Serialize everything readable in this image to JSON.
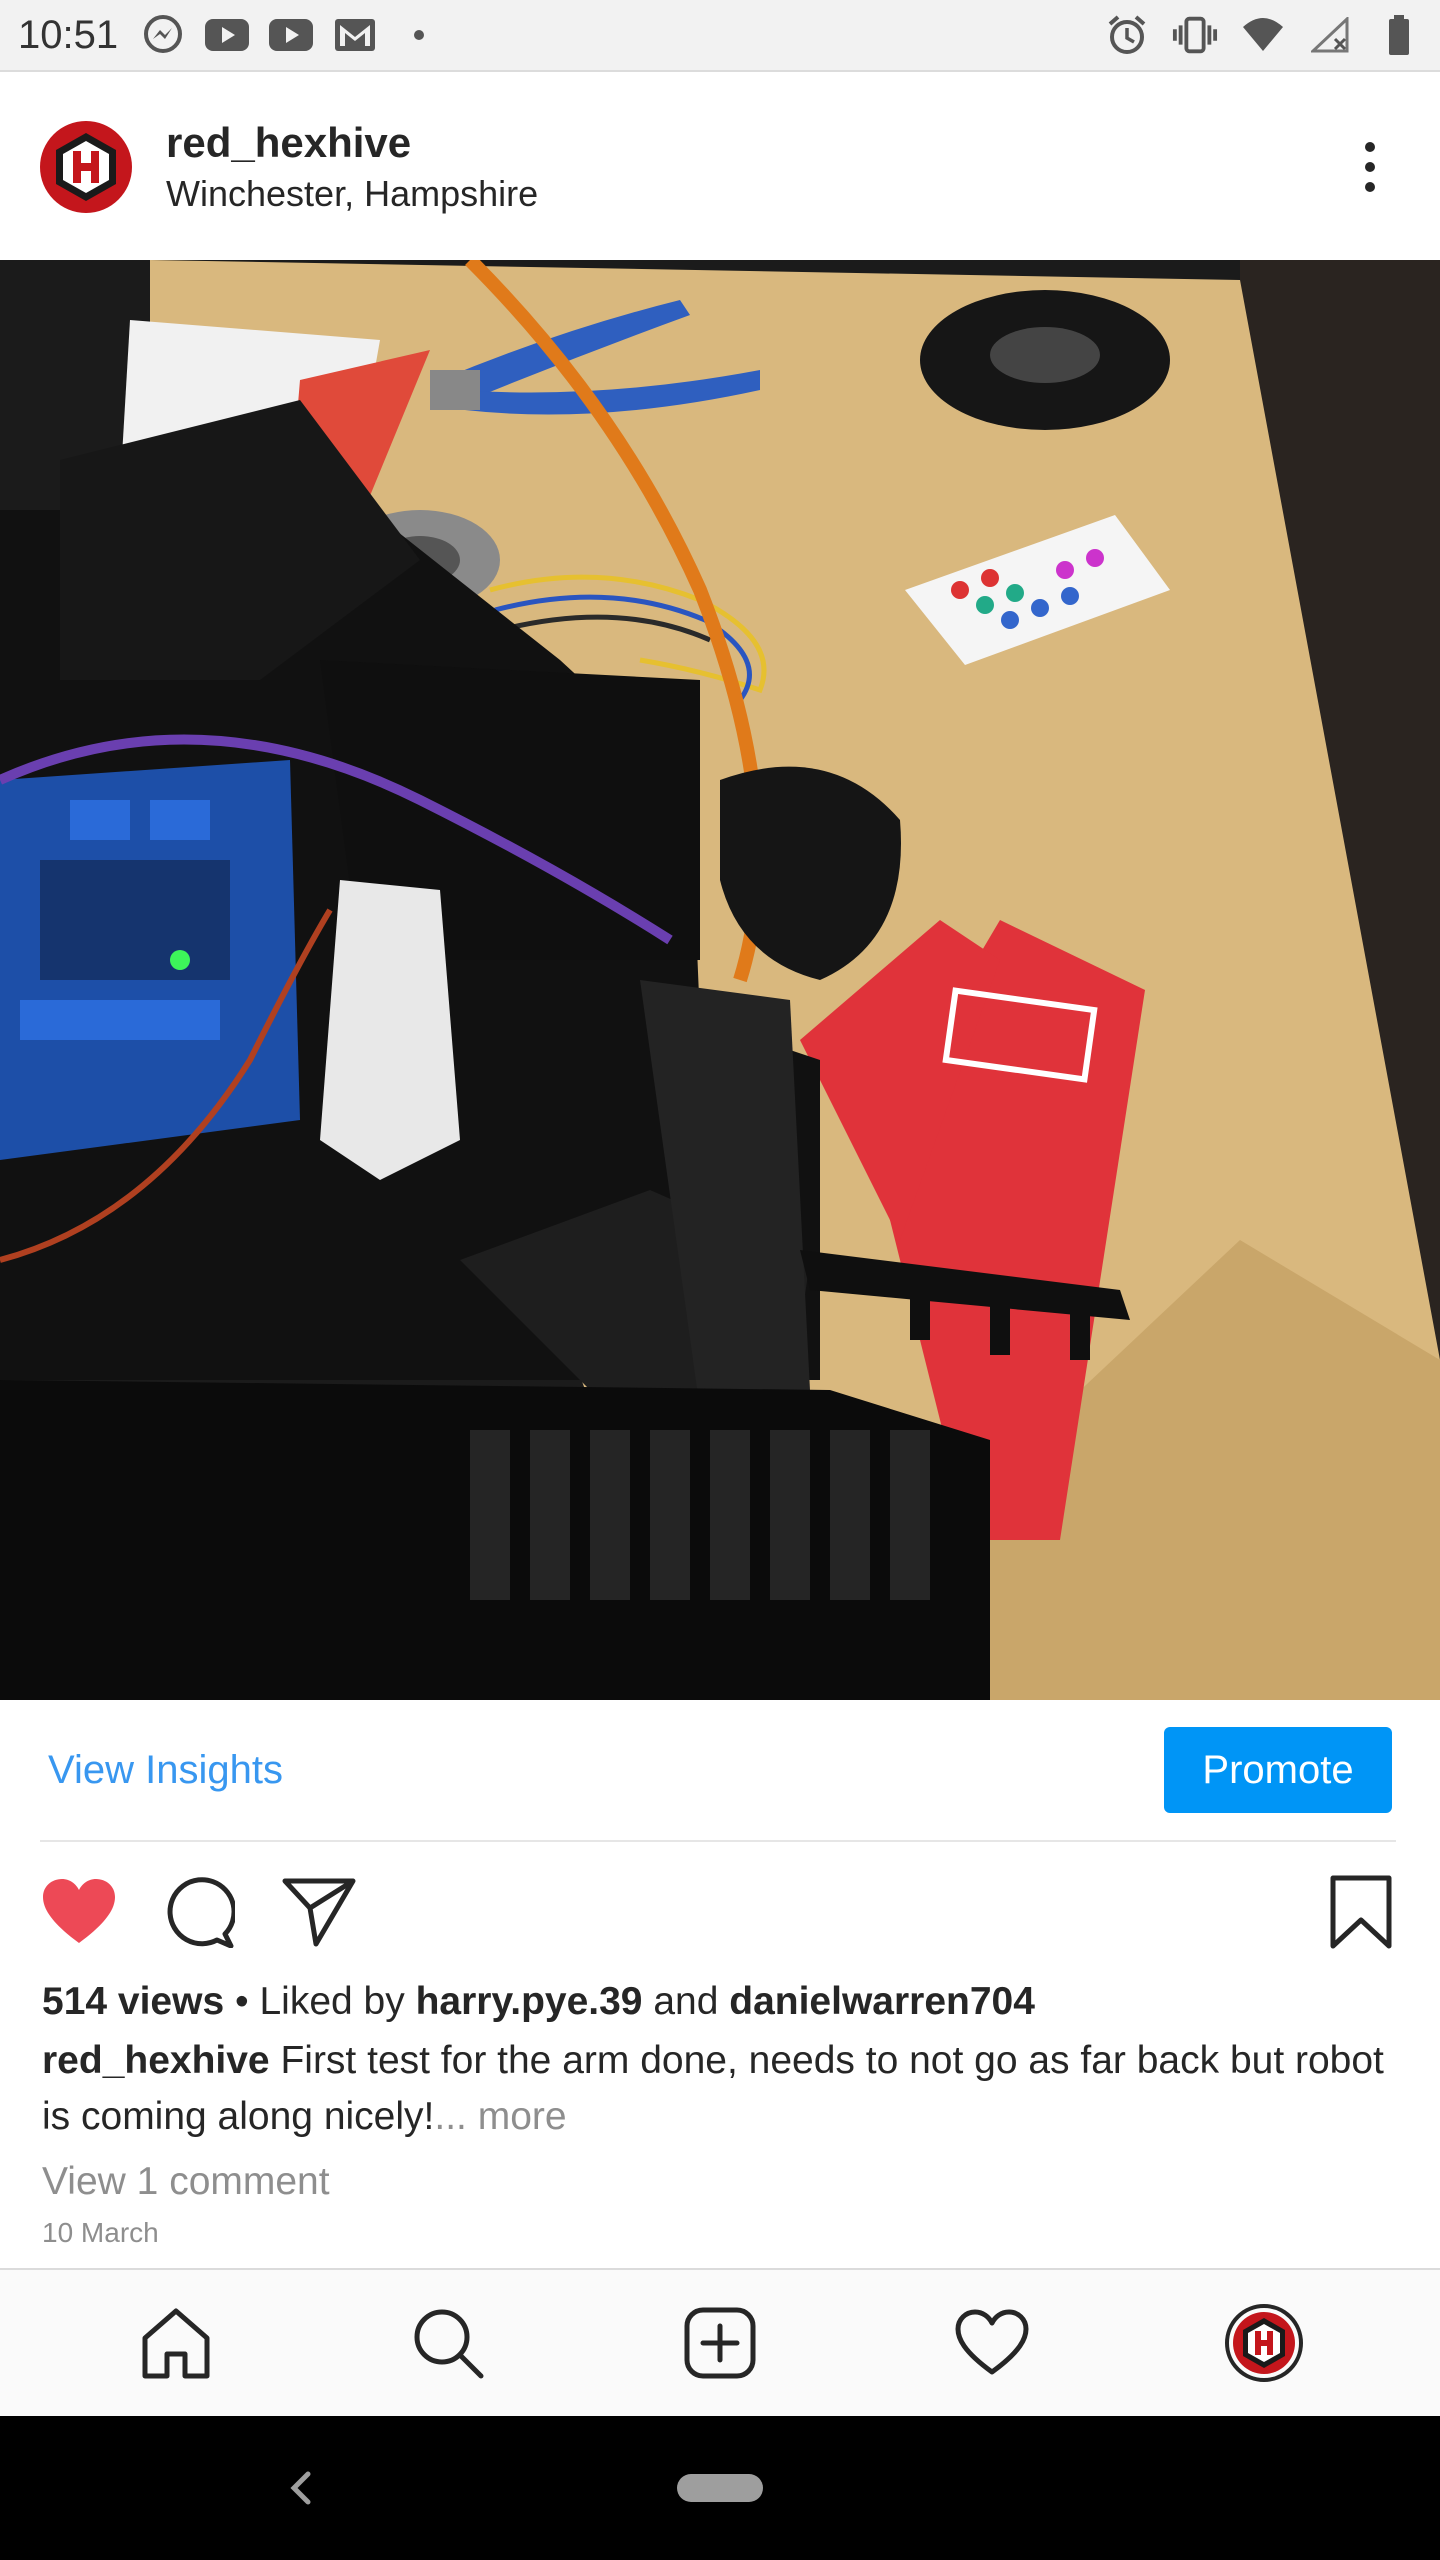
{
  "status_bar": {
    "time": "10:51",
    "left_icons": [
      "messenger-icon",
      "youtube-icon",
      "youtube-icon",
      "gmail-icon",
      "dot-icon"
    ],
    "right_icons": [
      "alarm-icon",
      "vibrate-icon",
      "wifi-icon",
      "signal-icon",
      "battery-icon"
    ]
  },
  "post": {
    "username": "red_hexhive",
    "location": "Winchester, Hampshire",
    "avatar_letter": "H",
    "brand_color": "#c4161c"
  },
  "insights": {
    "view_insights_label": "View Insights",
    "promote_label": "Promote"
  },
  "actions": {
    "liked": true,
    "like_color": "#ed4956"
  },
  "meta": {
    "views": "514 views",
    "separator": " • Liked by ",
    "liker1": "harry.pye.39",
    "and": " and ",
    "liker2": "danielwarren704",
    "caption_user": "red_hexhive",
    "caption_text": " First test for the arm done, needs to not go as far back but robot is coming along nicely!",
    "more_label": "... more",
    "view_comments": "View 1 comment",
    "date": "10 March"
  },
  "bottom_nav": {
    "items": [
      "home-icon",
      "search-icon",
      "new-post-icon",
      "activity-icon",
      "profile-icon"
    ]
  },
  "colors": {
    "accent": "#3897f0",
    "promote": "#0095f6",
    "muted": "#8e8e8e"
  }
}
